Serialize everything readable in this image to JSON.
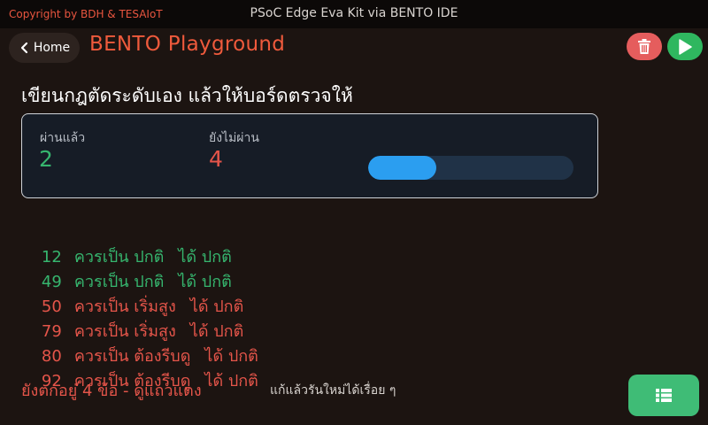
{
  "topbar": {
    "copyright": "Copyright by BDH & TESAIoT",
    "title": "PSoC Edge Eva Kit via BENTO IDE"
  },
  "header": {
    "home_label": "Home",
    "page_title": "BENTO Playground",
    "icons": {
      "back": "chevron-left-icon",
      "delete": "trash-icon",
      "run": "play-icon"
    }
  },
  "main": {
    "heading": "เขียนกฎตัดระดับเอง แล้วให้บอร์ดตรวจให้",
    "stats": {
      "pass_label": "ผ่านแล้ว",
      "pass_value": "2",
      "fail_label": "ยังไม่ผ่าน",
      "fail_value": "4",
      "progress_fraction": 0.3333
    },
    "results": [
      {
        "value": "12",
        "expected": "ควรเป็น ปกติ",
        "got": "ได้ ปกติ",
        "status": "pass"
      },
      {
        "value": "49",
        "expected": "ควรเป็น ปกติ",
        "got": "ได้ ปกติ",
        "status": "pass"
      },
      {
        "value": "50",
        "expected": "ควรเป็น เริ่มสูง",
        "got": "ได้ ปกติ",
        "status": "fail"
      },
      {
        "value": "79",
        "expected": "ควรเป็น เริ่มสูง",
        "got": "ได้ ปกติ",
        "status": "fail"
      },
      {
        "value": "80",
        "expected": "ควรเป็น ต้องรีบดู",
        "got": "ได้ ปกติ",
        "status": "fail"
      },
      {
        "value": "92",
        "expected": "ควรเป็น ต้องรีบดู",
        "got": "ได้ ปกติ",
        "status": "fail"
      }
    ],
    "summary": "ยังตกอยู่ 4 ข้อ - ดูแถวแดง",
    "hint": "แก้แล้วรันใหม่ได้เรื่อย ๆ"
  },
  "footer": {
    "list_icon": "list-icon"
  },
  "colors": {
    "pass": "#36b56e",
    "fail": "#e5554a",
    "accent": "#ef5a3c",
    "progress": "#2b9ef0"
  }
}
